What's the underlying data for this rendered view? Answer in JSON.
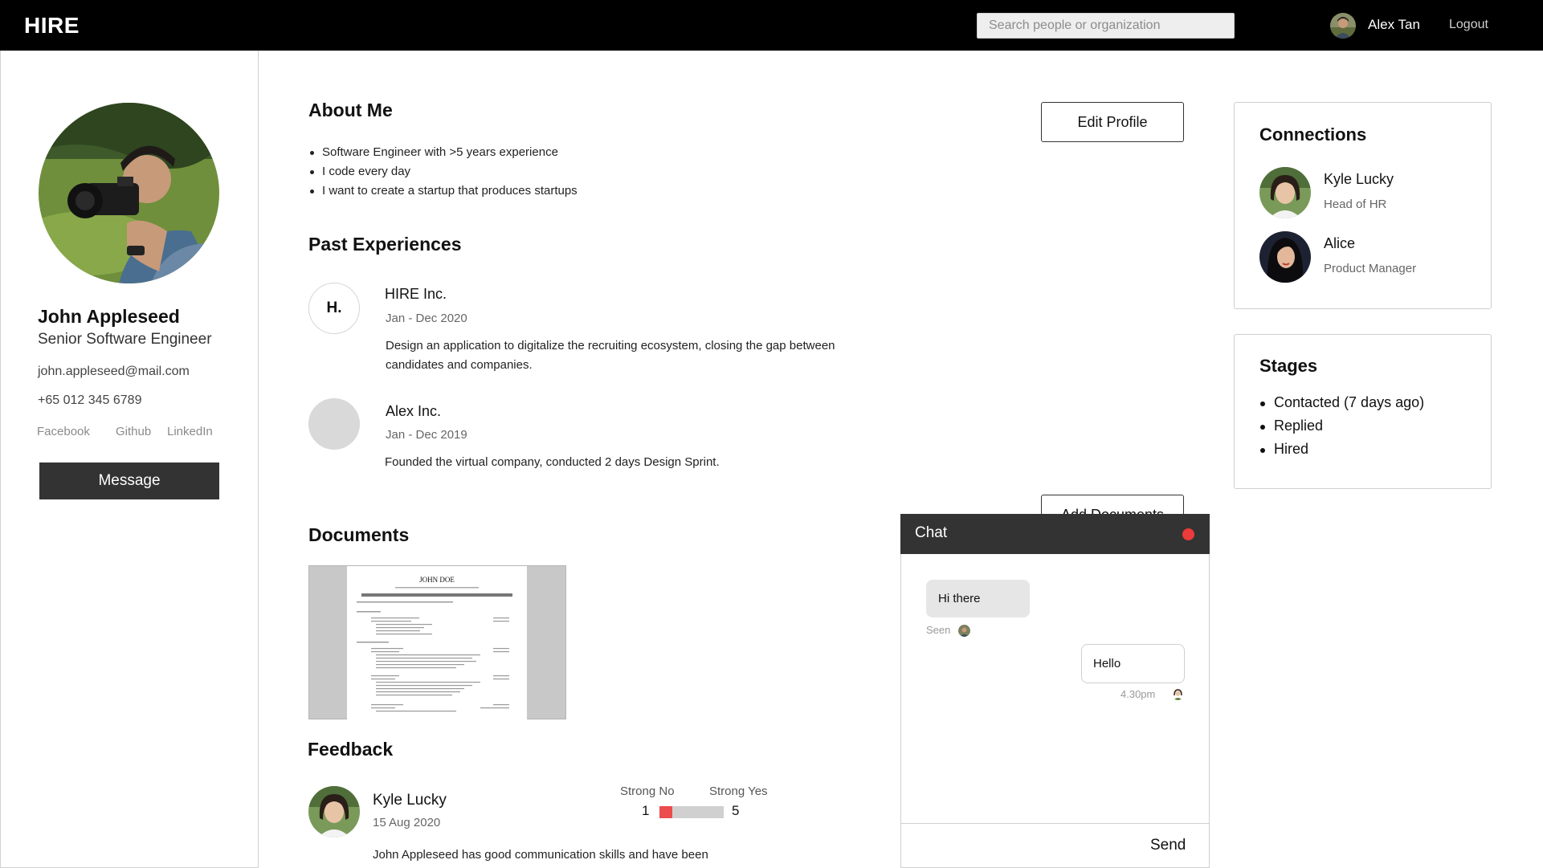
{
  "app": {
    "logo": "HIRE"
  },
  "header": {
    "search_placeholder": "Search people or organization",
    "user_name": "Alex Tan",
    "logout_label": "Logout"
  },
  "profile": {
    "name": "John Appleseed",
    "title": "Senior Software Engineer",
    "email": "john.appleseed@mail.com",
    "phone": "+65 012 345 6789",
    "social": [
      "Facebook",
      "Github",
      "LinkedIn"
    ],
    "message_label": "Message"
  },
  "about": {
    "title": "About Me",
    "items": [
      "Software Engineer with >5 years experience",
      "I code every day",
      "I want to create a startup that produces startups"
    ],
    "edit_label": "Edit Profile"
  },
  "experiences": {
    "title": "Past Experiences",
    "items": [
      {
        "logo_text": "H.",
        "company": "HIRE Inc.",
        "dates": "Jan - Dec 2020",
        "description": "Design an application to digitalize the recruiting ecosystem, closing the gap between candidates and companies."
      },
      {
        "logo_text": "",
        "company": "Alex Inc.",
        "dates": "Jan - Dec 2019",
        "description": "Founded the virtual company, conducted 2 days Design Sprint."
      }
    ]
  },
  "documents": {
    "title": "Documents",
    "add_label": "Add Documents",
    "resume_name": "JOHN DOE"
  },
  "feedback": {
    "title": "Feedback",
    "reviewer": "Kyle Lucky",
    "date": "15 Aug 2020",
    "scale_low_label": "Strong No",
    "scale_high_label": "Strong Yes",
    "scale_min": "1",
    "scale_max": "5",
    "score_fraction": 0.2,
    "text": "John Appleseed has good communication skills and have been"
  },
  "connections": {
    "title": "Connections",
    "items": [
      {
        "name": "Kyle Lucky",
        "role": "Head of HR"
      },
      {
        "name": "Alice",
        "role": "Product Manager"
      }
    ]
  },
  "stages": {
    "title": "Stages",
    "items": [
      "Contacted (7 days ago)",
      "Replied",
      "Hired"
    ]
  },
  "chat": {
    "title": "Chat",
    "messages": [
      {
        "text": "Hi there",
        "meta": "Seen"
      },
      {
        "text": "Hello",
        "meta": "4.30pm"
      }
    ],
    "send_label": "Send"
  },
  "colors": {
    "topbar": "#000000",
    "dark_button": "#333333",
    "accent_red": "#ec4c4c",
    "chat_close": "#ec3b3b"
  }
}
